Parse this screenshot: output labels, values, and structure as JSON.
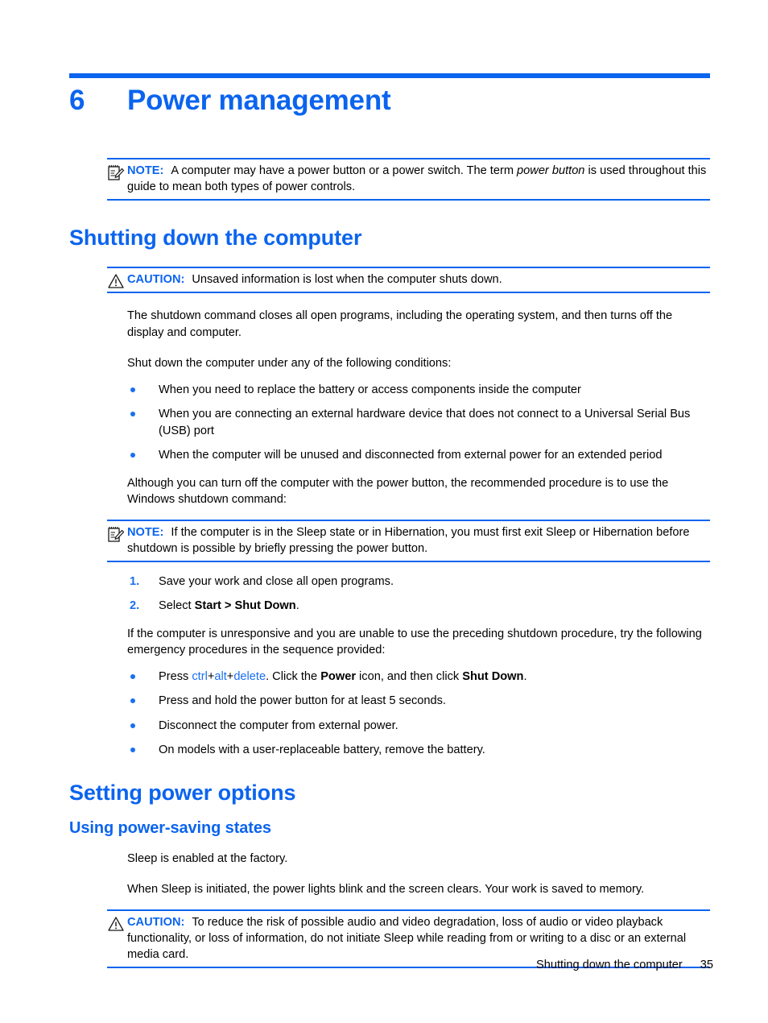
{
  "chapter": {
    "number": "6",
    "title": "Power management"
  },
  "note1": {
    "icon": "note-pad-pencil-icon",
    "label": "NOTE:",
    "text_part1": "A computer may have a power button or a power switch. The term ",
    "emphasis": "power button",
    "text_part2": " is used throughout this guide to mean both types of power controls."
  },
  "section1": {
    "heading": "Shutting down the computer",
    "caution": {
      "icon": "warning-triangle-icon",
      "label": "CAUTION:",
      "text": "Unsaved information is lost when the computer shuts down."
    },
    "paragraph1": "The shutdown command closes all open programs, including the operating system, and then turns off the display and computer.",
    "paragraph2": "Shut down the computer under any of the following conditions:",
    "bullets": [
      "When you need to replace the battery or access components inside the computer",
      "When you are connecting an external hardware device that does not connect to a Universal Serial Bus (USB) port",
      "When the computer will be unused and disconnected from external power for an extended period"
    ],
    "paragraph3": "Although you can turn off the computer with the power button, the recommended procedure is to use the Windows shutdown command:",
    "note": {
      "icon": "note-pad-pencil-icon",
      "label": "NOTE:",
      "text": "If the computer is in the Sleep state or in Hibernation, you must first exit Sleep or Hibernation before shutdown is possible by briefly pressing the power button."
    },
    "steps": [
      {
        "number": "1.",
        "text": "Save your work and close all open programs."
      },
      {
        "number": "2.",
        "prefix": "Select ",
        "bold": "Start > Shut Down",
        "suffix": "."
      }
    ],
    "paragraph4": "If the computer is unresponsive and you are unable to use the preceding shutdown procedure, try the following emergency procedures in the sequence provided:",
    "emergency_bullets": [
      {
        "lead": "Press ",
        "key1": "ctrl",
        "plus1": "+",
        "key2": "alt",
        "plus2": "+",
        "key3": "delete",
        "mid": ". Click the ",
        "bold1": "Power",
        "mid2": " icon, and then click ",
        "bold2": "Shut Down",
        "end": "."
      },
      {
        "text": "Press and hold the power button for at least 5 seconds."
      },
      {
        "text": "Disconnect the computer from external power."
      },
      {
        "text": "On models with a user-replaceable battery, remove the battery."
      }
    ]
  },
  "section2": {
    "heading": "Setting power options",
    "subheading": "Using power-saving states",
    "paragraph1": "Sleep is enabled at the factory.",
    "paragraph2": "When Sleep is initiated, the power lights blink and the screen clears. Your work is saved to memory.",
    "caution": {
      "icon": "warning-triangle-icon",
      "label": "CAUTION:",
      "text": "To reduce the risk of possible audio and video degradation, loss of audio or video playback functionality, or loss of information, do not initiate Sleep while reading from or writing to a disc or an external media card."
    }
  },
  "footer": {
    "running_head": "Shutting down the computer",
    "page_number": "35"
  },
  "colors": {
    "accent_blue": "#0b64ef",
    "link_blue": "#1a6ff0",
    "text_black": "#000000"
  }
}
